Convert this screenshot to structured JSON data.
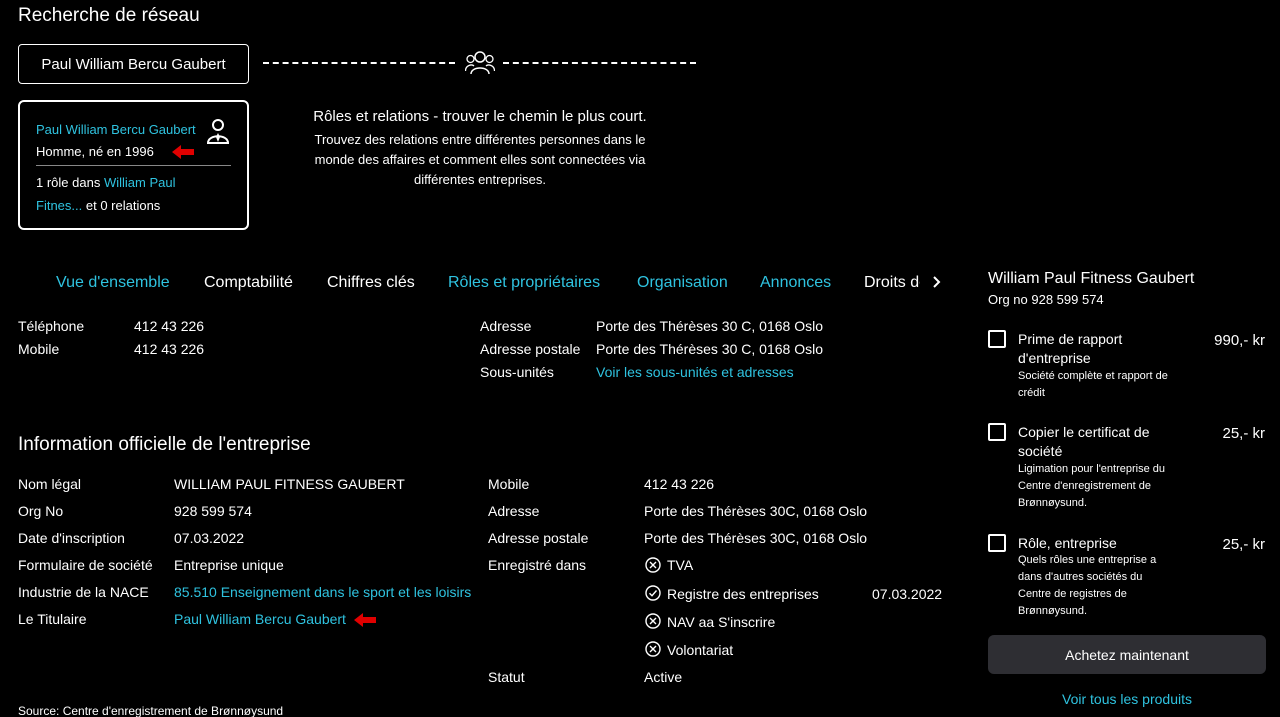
{
  "network": {
    "title": "Recherche de réseau",
    "person_button": "Paul William Bercu Gaubert",
    "card": {
      "name": "Paul William Bercu Gaubert",
      "gender": "Homme, né en 1996",
      "roles_prefix": "1 rôle dans",
      "roles_company": "William Paul Fitnes...",
      "roles_suffix": "et 0 relations"
    },
    "info_heading": "Rôles et relations - trouver le chemin le plus court.",
    "info_desc": "Trouvez des relations entre différentes personnes dans le monde des affaires et comment elles sont connectées via différentes entreprises."
  },
  "tabs": [
    {
      "label": "Vue d'ensemble",
      "active": true
    },
    {
      "label": "Comptabilité"
    },
    {
      "label": "Chiffres clés"
    },
    {
      "label": "Rôles et propriétaires",
      "active": true
    },
    {
      "label": "Organisation",
      "active": true
    },
    {
      "label": "Annonces",
      "active": true
    },
    {
      "label": "Droits de"
    }
  ],
  "contact": {
    "phone_label": "Téléphone",
    "phone": "412 43 226",
    "mobile_label": "Mobile",
    "mobile": "412 43 226",
    "address_label": "Adresse",
    "address": "Porte des Thérèses 30 C, 0168 Oslo",
    "postal_label": "Adresse postale",
    "postal": "Porte des Thérèses 30 C, 0168 Oslo",
    "subunits_label": "Sous-unités",
    "subunits_link": "Voir les sous-unités et adresses"
  },
  "official": {
    "title": "Information officielle de l'entreprise",
    "legal_name_label": "Nom légal",
    "legal_name": "WILLIAM PAUL FITNESS GAUBERT",
    "org_no_label": "Org No",
    "org_no": "928 599 574",
    "reg_date_label": "Date d'inscription",
    "reg_date": "07.03.2022",
    "form_label": "Formulaire de société",
    "form": "Entreprise unique",
    "nace_label": "Industrie de la NACE",
    "nace": "85.510 Enseignement dans le sport et les loisirs",
    "holder_label": "Le Titulaire",
    "holder": "Paul William Bercu Gaubert",
    "mobile_label": "Mobile",
    "mobile": "412 43 226",
    "address_label": "Adresse",
    "address": "Porte des Thérèses 30C, 0168 Oslo",
    "postal_label": "Adresse postale",
    "postal": "Porte des Thérèses 30C, 0168 Oslo",
    "registered_label": "Enregistré dans",
    "registers": [
      {
        "name": "TVA",
        "status": "no"
      },
      {
        "name": "Registre des entreprises",
        "status": "yes",
        "date": "07.03.2022"
      },
      {
        "name": "NAV aa S'inscrire",
        "status": "no"
      },
      {
        "name": "Volontariat",
        "status": "no"
      }
    ],
    "status_label": "Statut",
    "status": "Active"
  },
  "source": "Source: Centre d'enregistrement de Brønnøysund",
  "right_panel": {
    "company": "William Paul Fitness Gaubert",
    "org_no": "Org no 928 599 574",
    "products": [
      {
        "name": "Prime de rapport d'entreprise",
        "price": "990,- kr",
        "desc": "Société complète et rapport de crédit"
      },
      {
        "name": "Copier le certificat de société",
        "price": "25,- kr",
        "desc": "Ligimation pour l'entreprise du Centre d'enregistrement de Brønnøysund."
      },
      {
        "name": "Rôle, entreprise",
        "price": "25,- kr",
        "desc": "Quels rôles une entreprise a dans d'autres sociétés du Centre de registres de Brønnøysund."
      }
    ],
    "buy_label": "Achetez maintenant",
    "all_products": "Voir tous les produits"
  },
  "colors": {
    "link": "#2fc3e0",
    "arrow": "#e00000",
    "button_bg": "#2e2e33"
  },
  "icons": {
    "people": "people-group-icon",
    "user": "user-tie-icon",
    "arrow": "red-arrow-icon",
    "next": "chevron-right-icon"
  }
}
